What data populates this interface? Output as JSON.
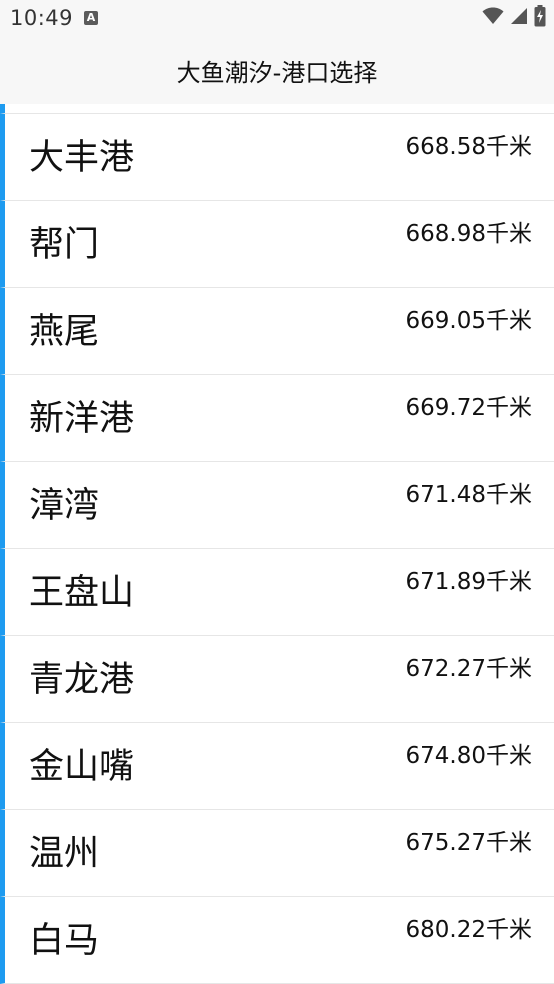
{
  "status_bar": {
    "time": "10:49",
    "notification_icon": "a-icon",
    "icons": [
      "wifi-icon",
      "signal-icon",
      "battery-charging-icon"
    ]
  },
  "app_bar": {
    "title": "大鱼潮汐-港口选择"
  },
  "ports": [
    {
      "name": "大丰港",
      "distance": "668.58千米"
    },
    {
      "name": "帮门",
      "distance": "668.98千米"
    },
    {
      "name": "燕尾",
      "distance": "669.05千米"
    },
    {
      "name": "新洋港",
      "distance": "669.72千米"
    },
    {
      "name": "漳湾",
      "distance": "671.48千米"
    },
    {
      "name": "王盘山",
      "distance": "671.89千米"
    },
    {
      "name": "青龙港",
      "distance": "672.27千米"
    },
    {
      "name": "金山嘴",
      "distance": "674.80千米"
    },
    {
      "name": "温州",
      "distance": "675.27千米"
    },
    {
      "name": "白马",
      "distance": "680.22千米"
    }
  ],
  "colors": {
    "accent": "#1e9bf0",
    "bar_background": "#f7f7f7",
    "divider": "#e6e6e6"
  }
}
